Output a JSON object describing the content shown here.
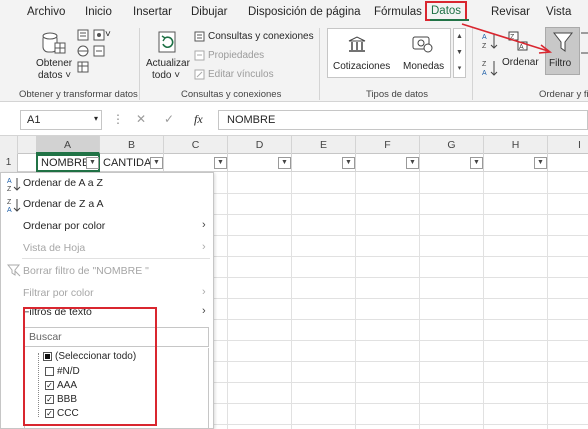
{
  "tabs": [
    "Archivo",
    "Inicio",
    "Insertar",
    "Dibujar",
    "Disposición de página",
    "Fórmulas",
    "Datos",
    "Revisar",
    "Vista"
  ],
  "ribbon": {
    "get_data": {
      "line1": "Obtener",
      "line2": "datos ˅",
      "group": "Obtener y transformar datos"
    },
    "refresh": {
      "line1": "Actualizar",
      "line2": "todo ˅"
    },
    "queries": {
      "connections": "Consultas y conexiones",
      "properties": "Propiedades",
      "edit_links": "Editar vínculos",
      "group": "Consultas y conexiones"
    },
    "datatypes": {
      "stocks": "Cotizaciones",
      "currencies": "Monedas",
      "group": "Tipos de datos"
    },
    "sort": {
      "label": "Ordenar",
      "filter": "Filtro",
      "group": "Ordenar y fi"
    }
  },
  "formula_bar": {
    "namebox": "A1",
    "fx": "fx",
    "value": "NOMBRE"
  },
  "columns": [
    "A",
    "B",
    "C",
    "D",
    "E",
    "F",
    "G",
    "H",
    "I"
  ],
  "row1": {
    "num": "1",
    "a": "NOMBRE",
    "b": "CANTIDA"
  },
  "menu": {
    "sort_az": "Ordenar de A a Z",
    "sort_za": "Ordenar de Z a A",
    "sort_color": "Ordenar por color",
    "sheet_view": "Vista de Hoja",
    "clear_filter": "Borrar filtro de \"NOMBRE \"",
    "filter_color": "Filtrar por color",
    "text_filters": "Filtros de texto",
    "search_placeholder": "Buscar",
    "items": [
      {
        "label": "(Seleccionar todo)",
        "state": "partial"
      },
      {
        "label": "#N/D",
        "state": "unchecked"
      },
      {
        "label": "AAA",
        "state": "checked"
      },
      {
        "label": "BBB",
        "state": "checked"
      },
      {
        "label": "CCC",
        "state": "checked"
      }
    ]
  },
  "colors": {
    "accent": "#217346",
    "highlight": "#d9262f"
  }
}
